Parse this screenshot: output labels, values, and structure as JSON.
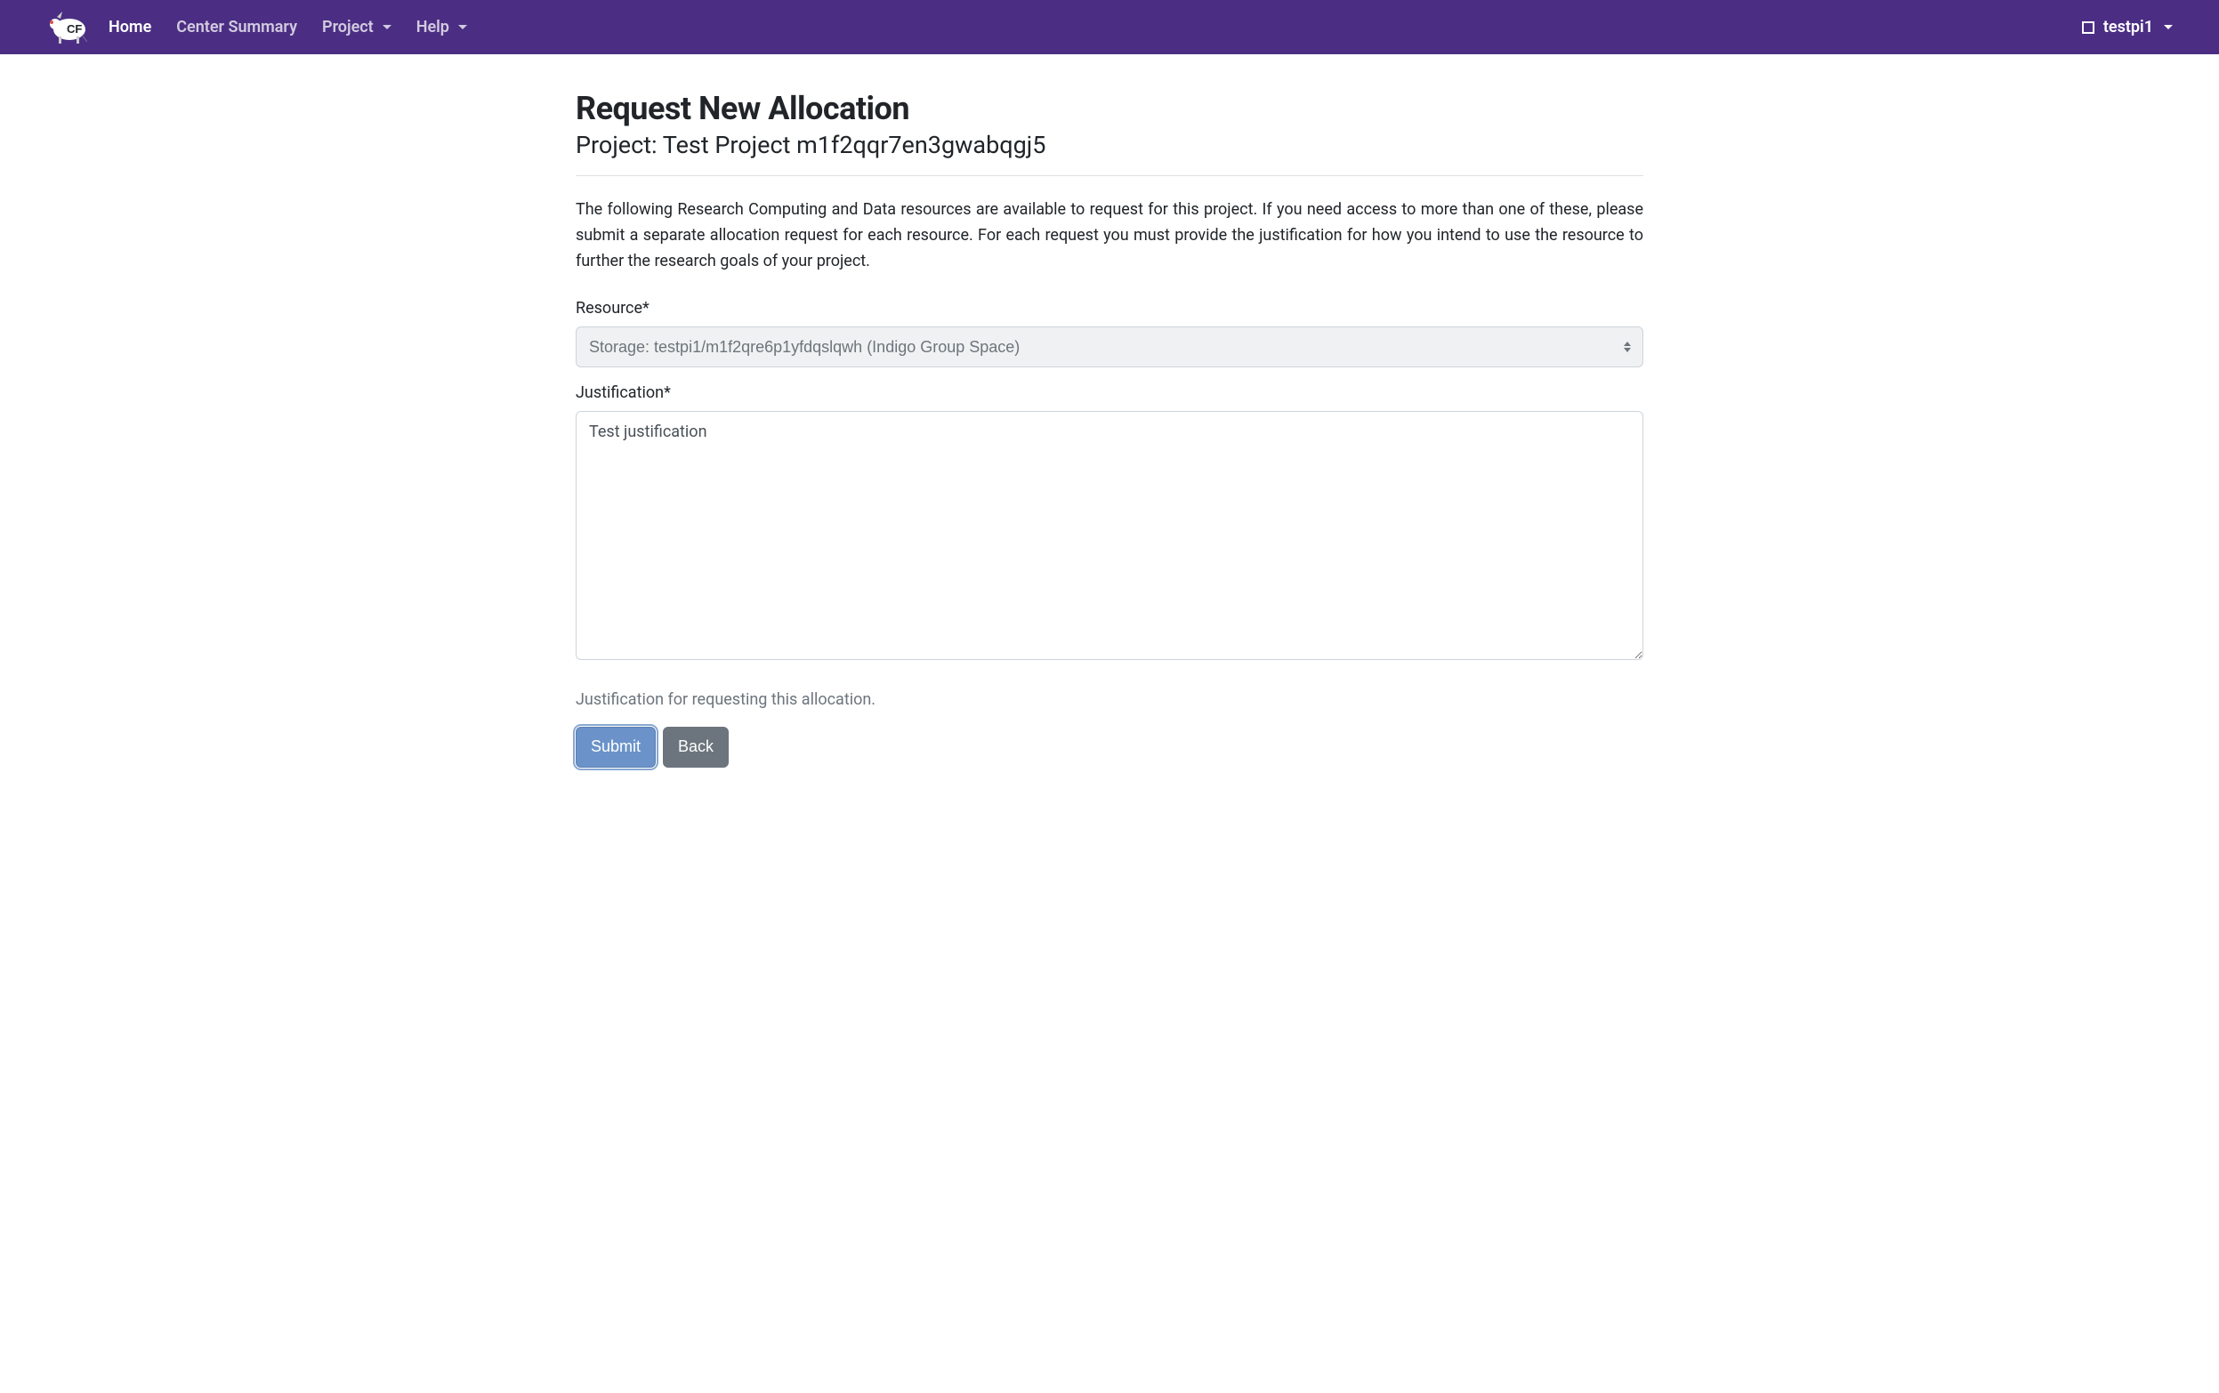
{
  "navbar": {
    "logo_text": "CF",
    "links": {
      "home": "Home",
      "center_summary": "Center Summary",
      "project": "Project",
      "help": "Help"
    },
    "user": "testpi1"
  },
  "page": {
    "title": "Request New Allocation",
    "subtitle": "Project: Test Project m1f2qqr7en3gwabqgj5",
    "description": "The following Research Computing and Data resources are available to request for this project. If you need access to more than one of these, please submit a separate allocation request for each resource. For each request you must provide the justification for how you intend to use the resource to further the research goals of your project."
  },
  "form": {
    "resource": {
      "label": "Resource*",
      "selected": "Storage: testpi1/m1f2qre6p1yfdqslqwh (Indigo Group Space)"
    },
    "justification": {
      "label": "Justification*",
      "value": "Test justification",
      "help": "Justification for requesting this allocation."
    },
    "buttons": {
      "submit": "Submit",
      "back": "Back"
    }
  }
}
